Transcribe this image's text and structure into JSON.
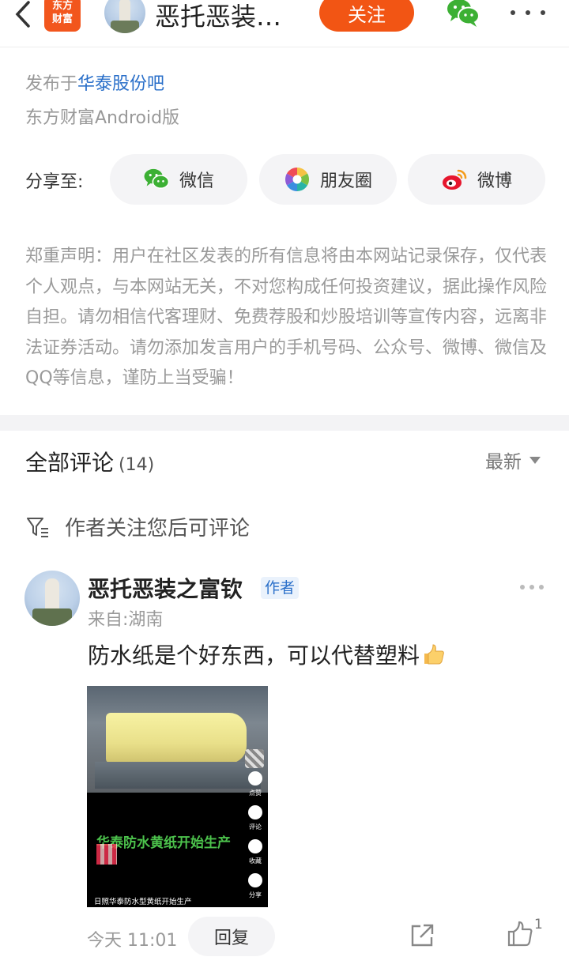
{
  "header": {
    "back_icon": "chevron-left-icon",
    "logo_line1": "东方",
    "logo_line2": "财富",
    "title": "恶托恶装…",
    "follow_label": "关注",
    "wechat_icon": "wechat-icon",
    "more_icon": "more-dots-icon"
  },
  "publish": {
    "prefix": "发布于",
    "bar_name": "华泰股份吧",
    "client": "东方财富Android版"
  },
  "share": {
    "label": "分享至:",
    "buttons": [
      {
        "label": "微信",
        "icon": "wechat-icon"
      },
      {
        "label": "朋友圈",
        "icon": "moments-icon"
      },
      {
        "label": "微博",
        "icon": "weibo-icon"
      }
    ]
  },
  "disclaimer": "郑重声明：用户在社区发表的所有信息将由本网站记录保存，仅代表个人观点，与本网站无关，不对您构成任何投资建议，据此操作风险自担。请勿相信代客理财、免费荐股和炒股培训等宣传内容，远离非法证券活动。请勿添加发言用户的手机号码、公众号、微博、微信及QQ等信息，谨防上当受骗！",
  "comments": {
    "title": "全部评论",
    "count": "(14)",
    "sort_label": "最新",
    "notice": "作者关注您后可评论",
    "items": [
      {
        "author": "恶托恶装之富钦",
        "badge": "作者",
        "from": "来自:湖南",
        "text": "防水纸是个好东西，可以代替塑料",
        "media_overlay_text": "华泰防水黄纸开始生产",
        "media_caption": "日照华泰防水型黄纸开始生产",
        "media_side_labels": [
          "点赞",
          "评论",
          "收藏",
          "分享"
        ],
        "time": "今天 11:01",
        "reply_label": "回复",
        "like_count": "1"
      }
    ]
  },
  "colors": {
    "accent": "#f25514",
    "link": "#2a6fc9",
    "muted": "#999999"
  }
}
